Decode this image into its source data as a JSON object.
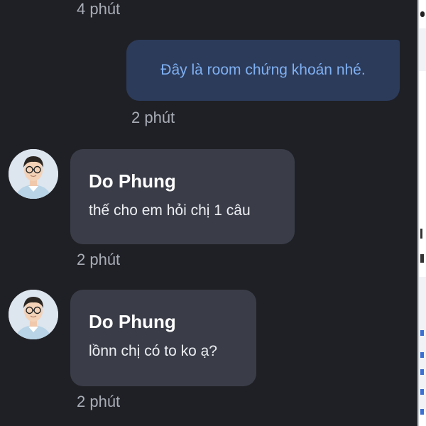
{
  "conversation": {
    "top_timestamp": "4 phút",
    "outgoing": {
      "text": "Đây là room chứng khoán nhé.",
      "timestamp": "2 phút"
    },
    "incoming": [
      {
        "sender": "Do Phung",
        "text": "thế cho em hỏi chị 1 câu",
        "timestamp": "2 phút"
      },
      {
        "sender": "Do Phung",
        "text": "lồnn chị có to ko ạ?",
        "timestamp": "2 phút"
      }
    ]
  },
  "colors": {
    "background": "#1f2025",
    "outgoing_bubble": "#2c3b5a",
    "outgoing_text": "#7fb0f2",
    "incoming_bubble": "#3a3d48",
    "timestamp": "#a9adb6"
  },
  "icons": {
    "avatar": "person-avatar"
  }
}
